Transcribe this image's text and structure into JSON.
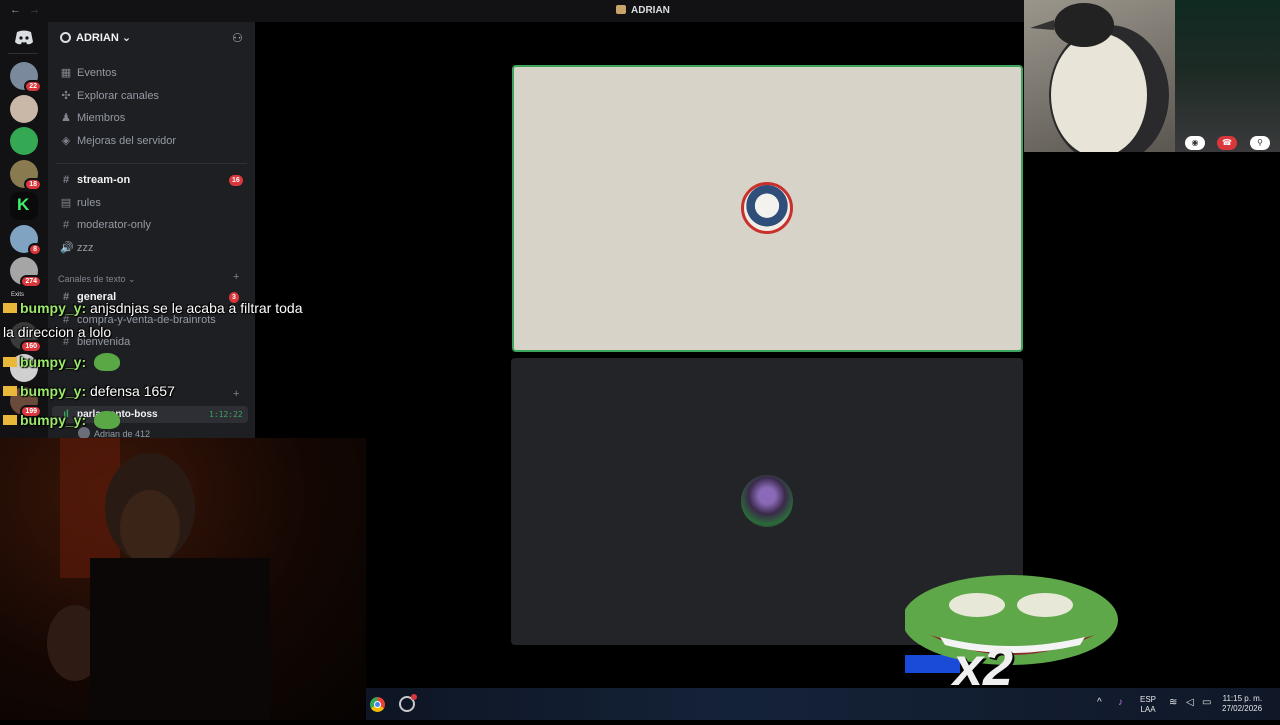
{
  "titlebar": {
    "back": "←",
    "forward": "→",
    "title": "ADRIAN"
  },
  "guilds": [
    {
      "color": "#7a8a9c",
      "badge": "22"
    },
    {
      "color": "#c9b8a8",
      "badge": ""
    },
    {
      "color": "#34a853",
      "badge": ""
    },
    {
      "color": "#8a7a50",
      "badge": "18"
    },
    {
      "color": "#0a0a0a",
      "badge": ""
    },
    {
      "color": "#7fa3c0",
      "badge": "8"
    },
    {
      "color": "#a5a5a5",
      "badge": "274"
    },
    {
      "color": "#3a3a3a",
      "badge": "160"
    },
    {
      "color": "#d0d0d0",
      "badge": ""
    },
    {
      "color": "#6a4a3a",
      "badge": "199"
    }
  ],
  "guild_label": "Exits",
  "server": {
    "name": "ADRIAN"
  },
  "menu": [
    {
      "icon": "▦",
      "label": "Eventos"
    },
    {
      "icon": "✣",
      "label": "Explorar canales"
    },
    {
      "icon": "♟",
      "label": "Miembros"
    },
    {
      "icon": "◈",
      "label": "Mejoras del servidor"
    }
  ],
  "channels_top": [
    {
      "icon": "#",
      "label": "stream-on",
      "badge": "16",
      "bold": true
    },
    {
      "icon": "▤",
      "label": "rules",
      "badge": ""
    },
    {
      "icon": "#",
      "label": "moderator-only",
      "badge": ""
    },
    {
      "icon": "🔊",
      "label": "zzz",
      "badge": ""
    }
  ],
  "category_text": "Canales de texto",
  "channels_text": [
    {
      "icon": "#",
      "label": "general",
      "badge": "3"
    },
    {
      "icon": "#",
      "label": "compra-y-venta-de-brainrots"
    },
    {
      "icon": "#",
      "label": "bienvenida"
    }
  ],
  "voice_channel": {
    "label": "parlamento-boss",
    "time": "1:12:22",
    "user": "Adrian de 412"
  },
  "chat": [
    {
      "user": "bumpy_y:",
      "text": "anjsdnjas se le acaba a filtrar toda"
    },
    {
      "user": "",
      "text": "la direccion a lolo"
    },
    {
      "user": "bumpy_y:",
      "text": ""
    },
    {
      "user": "bumpy_y:",
      "text": "defensa 1657"
    },
    {
      "user": "bumpy_y:",
      "text": ""
    }
  ],
  "call_controls": {
    "camera": "camera-icon",
    "hangup": "hangup-icon",
    "mic": "mic-icon"
  },
  "overlay_text": "x2",
  "taskbar": {
    "lang1": "ESP",
    "lang2": "LAA",
    "time": "11:15 p. m.",
    "date": "27/02/2026"
  },
  "colors": {
    "speaking": "#3ba55c",
    "badge": "#da373c",
    "chat_user": "#9be86a"
  }
}
